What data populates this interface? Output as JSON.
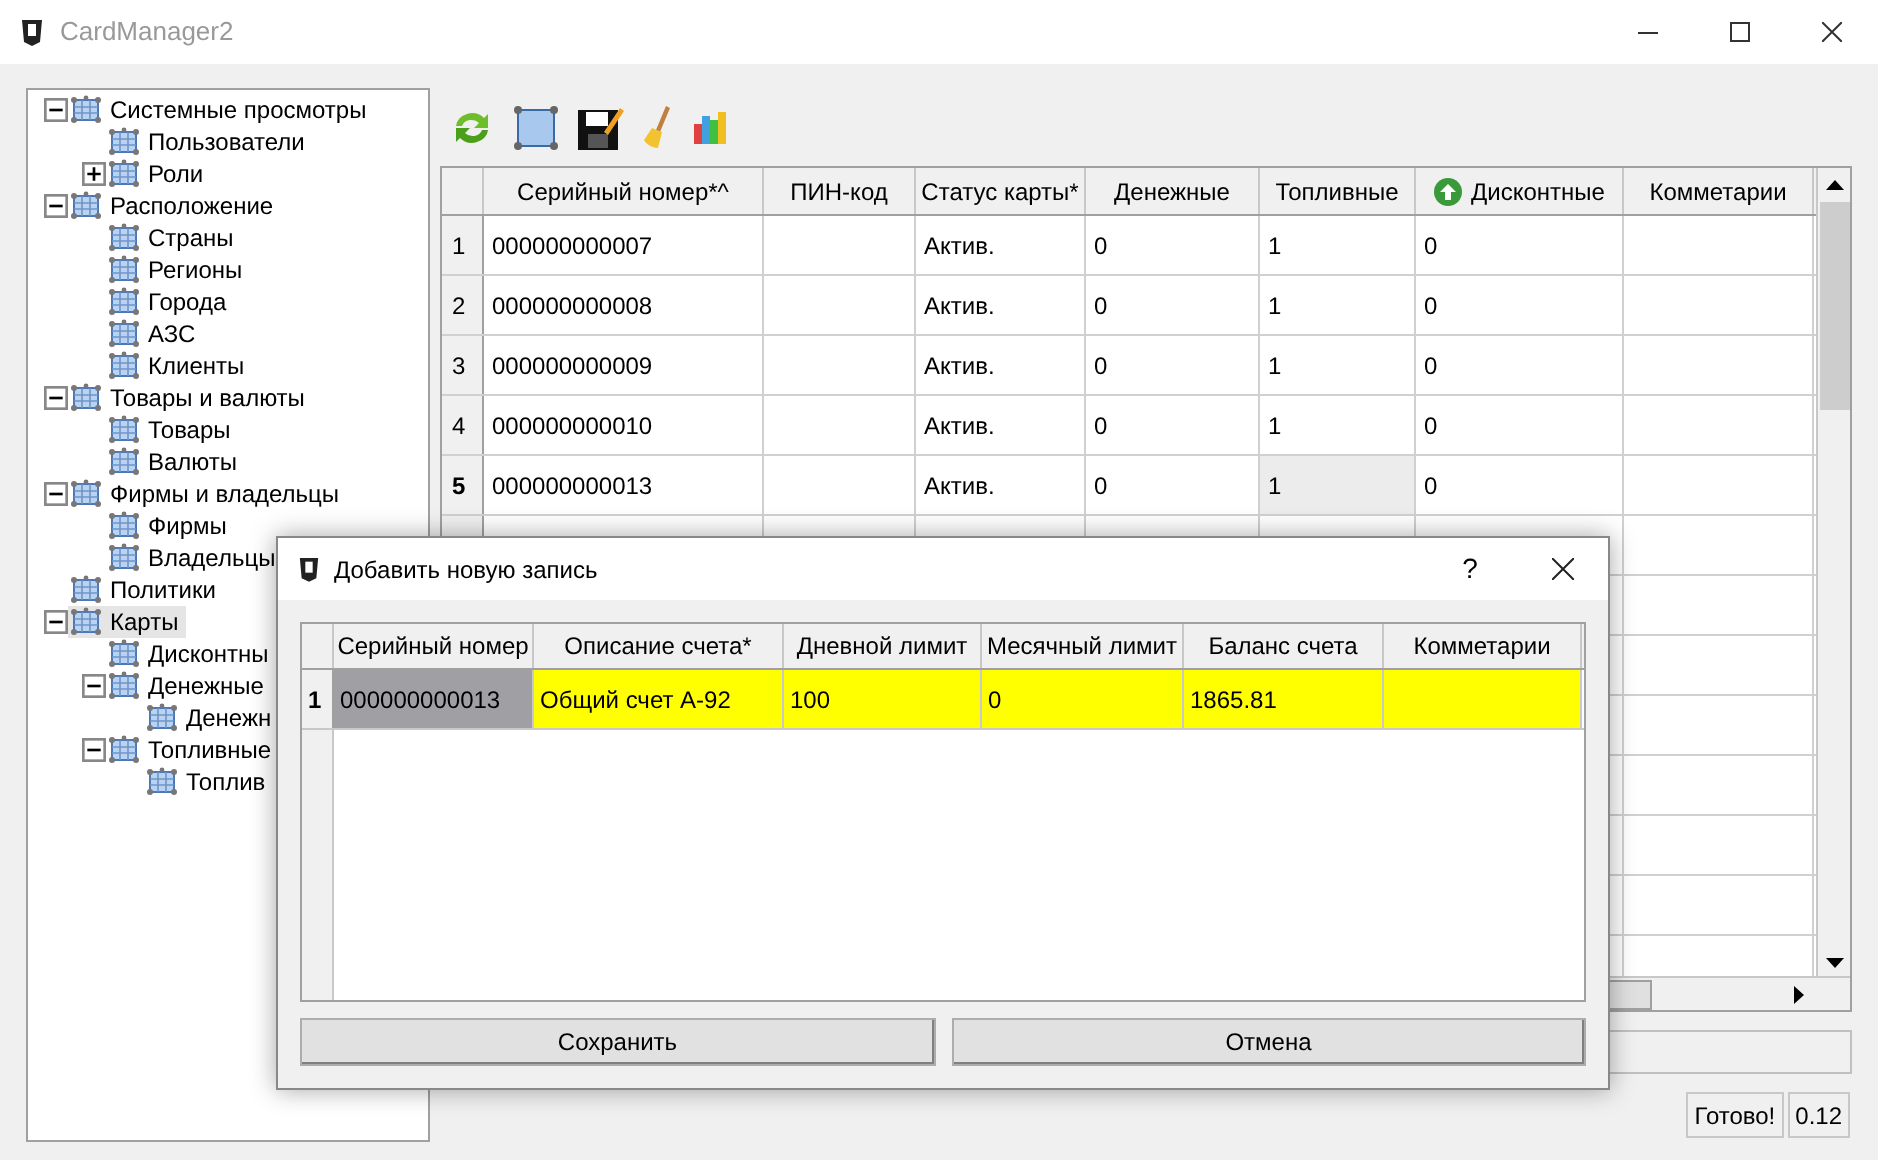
{
  "window": {
    "title": "CardManager2"
  },
  "tree": [
    {
      "label": "Системные просмотры",
      "expanded": true,
      "selected": false,
      "children": [
        {
          "label": "Пользователи",
          "selected": false
        },
        {
          "label": "Роли",
          "expanded": false,
          "selected": false
        }
      ]
    },
    {
      "label": "Расположение",
      "expanded": true,
      "selected": false,
      "children": [
        {
          "label": "Страны",
          "selected": false
        },
        {
          "label": "Регионы",
          "selected": false
        },
        {
          "label": "Города",
          "selected": false
        },
        {
          "label": "АЗС",
          "selected": false
        },
        {
          "label": "Клиенты",
          "selected": false
        }
      ]
    },
    {
      "label": "Товары и валюты",
      "expanded": true,
      "selected": false,
      "children": [
        {
          "label": "Товары",
          "selected": false
        },
        {
          "label": "Валюты",
          "selected": false
        }
      ]
    },
    {
      "label": "Фирмы и владельцы",
      "expanded": true,
      "selected": false,
      "children": [
        {
          "label": "Фирмы",
          "selected": false
        },
        {
          "label": "Владельцы",
          "selected": false
        }
      ]
    },
    {
      "label": "Политики",
      "selected": false
    },
    {
      "label": "Карты",
      "expanded": true,
      "selected": true,
      "children": [
        {
          "label": "Дисконтны",
          "selected": false
        },
        {
          "label": "Денежные",
          "expanded": true,
          "selected": false,
          "children": [
            {
              "label": "Денежн",
              "selected": false
            }
          ]
        },
        {
          "label": "Топливные",
          "expanded": true,
          "selected": false,
          "children": [
            {
              "label": "Топлив",
              "selected": false
            }
          ]
        }
      ]
    }
  ],
  "table": {
    "columns": [
      {
        "label": "Серийный номер*^"
      },
      {
        "label": "ПИН-код"
      },
      {
        "label": "Статус карты*"
      },
      {
        "label": "Денежные"
      },
      {
        "label": "Топливные"
      },
      {
        "label": "Дисконтные",
        "sorted": true
      },
      {
        "label": "Комметарии"
      }
    ],
    "rows": [
      {
        "header": "1",
        "selected": false,
        "cells": [
          {
            "text": "000000000007",
            "focused": false
          },
          {
            "text": "",
            "focused": false
          },
          {
            "text": "Актив.",
            "focused": false
          },
          {
            "text": "0",
            "focused": false
          },
          {
            "text": "1",
            "focused": false
          },
          {
            "text": "0",
            "focused": false
          },
          {
            "text": "",
            "focused": false
          }
        ]
      },
      {
        "header": "2",
        "selected": false,
        "cells": [
          {
            "text": "000000000008",
            "focused": false
          },
          {
            "text": "",
            "focused": false
          },
          {
            "text": "Актив.",
            "focused": false
          },
          {
            "text": "0",
            "focused": false
          },
          {
            "text": "1",
            "focused": false
          },
          {
            "text": "0",
            "focused": false
          },
          {
            "text": "",
            "focused": false
          }
        ]
      },
      {
        "header": "3",
        "selected": false,
        "cells": [
          {
            "text": "000000000009",
            "focused": false
          },
          {
            "text": "",
            "focused": false
          },
          {
            "text": "Актив.",
            "focused": false
          },
          {
            "text": "0",
            "focused": false
          },
          {
            "text": "1",
            "focused": false
          },
          {
            "text": "0",
            "focused": false
          },
          {
            "text": "",
            "focused": false
          }
        ]
      },
      {
        "header": "4",
        "selected": false,
        "cells": [
          {
            "text": "000000000010",
            "focused": false
          },
          {
            "text": "",
            "focused": false
          },
          {
            "text": "Актив.",
            "focused": false
          },
          {
            "text": "0",
            "focused": false
          },
          {
            "text": "1",
            "focused": false
          },
          {
            "text": "0",
            "focused": false
          },
          {
            "text": "",
            "focused": false
          }
        ]
      },
      {
        "header": "5",
        "selected": true,
        "cells": [
          {
            "text": "000000000013",
            "focused": false
          },
          {
            "text": "",
            "focused": false
          },
          {
            "text": "Актив.",
            "focused": false
          },
          {
            "text": "0",
            "focused": false
          },
          {
            "text": "1",
            "focused": true
          },
          {
            "text": "0",
            "focused": false
          },
          {
            "text": "",
            "focused": false
          }
        ]
      }
    ]
  },
  "status_bar": {
    "message": "Готово!",
    "version": "0.12"
  },
  "dialog": {
    "title": "Добавить новую запись",
    "help": "?",
    "columns": [
      {
        "label": "Серийный номер"
      },
      {
        "label": "Описание счета*"
      },
      {
        "label": "Дневной лимит"
      },
      {
        "label": "Месячный лимит"
      },
      {
        "label": "Баланс счета"
      },
      {
        "label": "Комметарии"
      }
    ],
    "rows": [
      {
        "header": "1",
        "cells": [
          {
            "text": "000000000013",
            "editable": false
          },
          {
            "text": "Общий счет А-92",
            "editable": true
          },
          {
            "text": "100",
            "editable": true
          },
          {
            "text": "0",
            "editable": true
          },
          {
            "text": "1865.81",
            "editable": true
          },
          {
            "text": "",
            "editable": true
          }
        ]
      }
    ],
    "buttons": [
      {
        "label": "Сохранить"
      },
      {
        "label": "Отмена"
      }
    ]
  }
}
